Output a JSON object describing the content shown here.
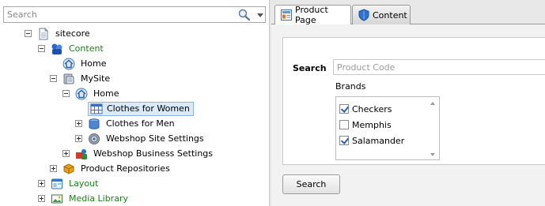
{
  "search": {
    "placeholder": "Search",
    "value": ""
  },
  "tree": [
    {
      "label": "sitecore",
      "icon": "document-icon",
      "toggle": "collapse",
      "color": "#000000"
    },
    {
      "label": "Content",
      "icon": "content-icon",
      "toggle": "collapse",
      "color": "#1e7d1e"
    },
    {
      "label": "Home",
      "icon": "home-icon",
      "toggle": "none",
      "color": "#000000"
    },
    {
      "label": "MySite",
      "icon": "site-icon",
      "toggle": "collapse",
      "color": "#000000"
    },
    {
      "label": "Home",
      "icon": "home-icon",
      "toggle": "collapse",
      "color": "#000000"
    },
    {
      "label": "Clothes for Women",
      "icon": "grid-icon",
      "toggle": "none",
      "color": "#000000",
      "selected": true
    },
    {
      "label": "Clothes for Men",
      "icon": "cylinder-icon",
      "toggle": "expand",
      "color": "#000000"
    },
    {
      "label": "Webshop Site Settings",
      "icon": "gear-icon",
      "toggle": "expand",
      "color": "#000000"
    },
    {
      "label": "Webshop Business Settings",
      "icon": "business-icon",
      "toggle": "expand",
      "color": "#000000"
    },
    {
      "label": "Product Repositories",
      "icon": "box-icon",
      "toggle": "expand",
      "color": "#000000"
    },
    {
      "label": "Layout",
      "icon": "layout-icon",
      "toggle": "expand",
      "color": "#1e7d1e"
    },
    {
      "label": "Media Library",
      "icon": "media-icon",
      "toggle": "expand",
      "color": "#1e7d1e"
    }
  ],
  "tabs": [
    {
      "label": "Product Page",
      "icon": "product-page-icon",
      "active": true
    },
    {
      "label": "Content",
      "icon": "shield-icon",
      "active": false
    }
  ],
  "form": {
    "search_label": "Search",
    "product_code_placeholder": "Product Code",
    "brands_label": "Brands",
    "brands": [
      {
        "label": "Checkers",
        "checked": true
      },
      {
        "label": "Memphis",
        "checked": false
      },
      {
        "label": "Salamander",
        "checked": true
      }
    ],
    "search_button": "Search"
  },
  "colors": {
    "selection_bg": "#dceaf7",
    "green_text": "#1e7d1e",
    "check": "#2b5fa5"
  }
}
